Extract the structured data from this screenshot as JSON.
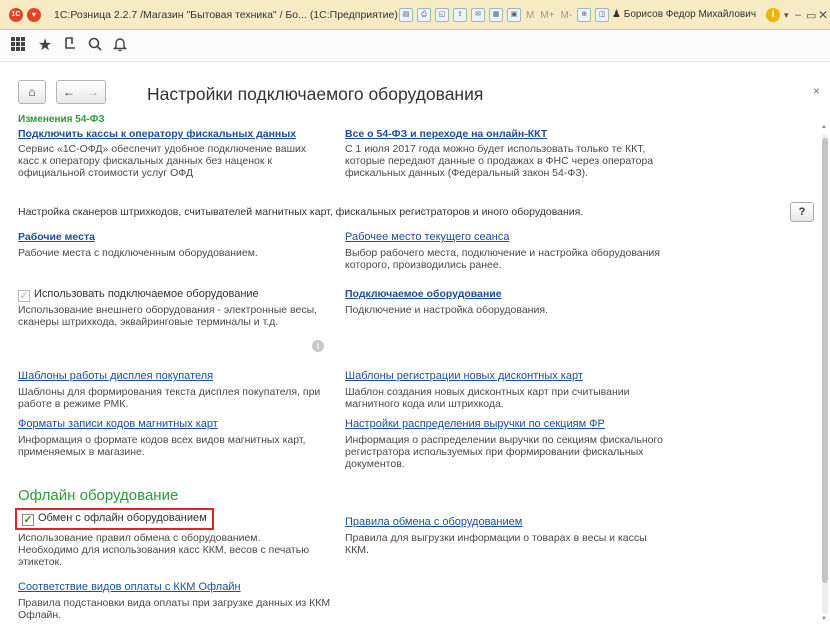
{
  "titlebar": {
    "logo": "1С",
    "title": "1С:Розница 2.2.7 /Магазин \"Бытовая техника\" / Бо... (1С:Предприятие)",
    "m": "M",
    "mplus": "M+",
    "mminus": "M-",
    "user": "Борисов Федор Михайлович",
    "min": "–",
    "max": "▭",
    "close": "✕"
  },
  "page": {
    "title": "Настройки подключаемого оборудования",
    "close": "×"
  },
  "sections": {
    "changes": {
      "header": "Изменения 54-ФЗ",
      "link_left": "Подключить кассы к оператору фискальных данных",
      "desc_left": [
        "Сервис «1С-ОФД» обеспечит удобное подключение ваших",
        "касс к оператору фискальных данных без наценок к",
        "официальной стоимости услуг ОФД"
      ],
      "link_right": "Все о 54-ФЗ и переходе на онлайн-ККТ",
      "desc_right": [
        "С 1 июля 2017 года можно будет использовать только те ККТ,",
        "которые передают данные о продажах в ФНС через оператора",
        "фискальных данных (Федеральный закон 54-ФЗ)."
      ]
    },
    "info_text": "Настройка сканеров штрихкодов, считывателей магнитных карт, фискальных регистраторов и иного оборудования.",
    "help": "?",
    "workplaces": {
      "link": "Рабочие места",
      "desc": "Рабочие места с подключенным оборудованием."
    },
    "session": {
      "link": "Рабочее место текущего сеанса",
      "desc": [
        "Выбор рабочего места, подключение и настройка оборудования",
        "которого, производились ранее."
      ]
    },
    "use_equipment": {
      "label": "Использовать подключаемое оборудование",
      "desc": [
        "Использование внешнего оборудования - электронные весы,",
        "сканеры штрихкода, эквайринговые терминалы и т.д."
      ]
    },
    "connected": {
      "link": "Подключаемое оборудование",
      "desc": "Подключение и настройка оборудования."
    },
    "display_templates": {
      "link": "Шаблоны работы дисплея покупателя",
      "desc": [
        "Шаблоны для формирования текста дисплея покупателя, при",
        "работе в режиме РМК."
      ]
    },
    "discount_templates": {
      "link": "Шаблоны регистрации новых дисконтных карт",
      "desc": [
        "Шаблон создания новых дисконтных карт при считывании",
        "магнитного кода или штрихкода."
      ]
    },
    "card_formats": {
      "link": "Форматы записи кодов магнитных карт",
      "desc": [
        "Информация о формате кодов всех видов магнитных карт,",
        "применяемых в магазине."
      ]
    },
    "revenue": {
      "link": "Настройки распределения выручки по секциям ФР",
      "desc": [
        "Информация о распределении выручки по секциям фискального",
        "регистратора используемых при формировании фискальных",
        "документов."
      ]
    },
    "offline": {
      "header": "Офлайн оборудование",
      "exchange_label": "Обмен с офлайн оборудованием",
      "exchange_desc": [
        "Использование правил обмена с оборудованием.",
        "Необходимо для использования касс ККМ, весов с печатью",
        "этикеток."
      ],
      "rules_link": "Правила обмена с оборудованием",
      "rules_desc": [
        "Правила для выгрузки информации о товарах в весы и кассы",
        "ККМ."
      ],
      "payment_link": "Соответствие видов оплаты с ККМ Офлайн",
      "payment_desc": [
        "Правила подстановки вида оплаты при загрузке данных из ККМ",
        "Офлайн."
      ]
    }
  },
  "colors": {
    "accent_green": "#2d9b34",
    "link": "#1c4e9b",
    "highlight": "#e02424",
    "titlebar": "#f7ebc4"
  }
}
